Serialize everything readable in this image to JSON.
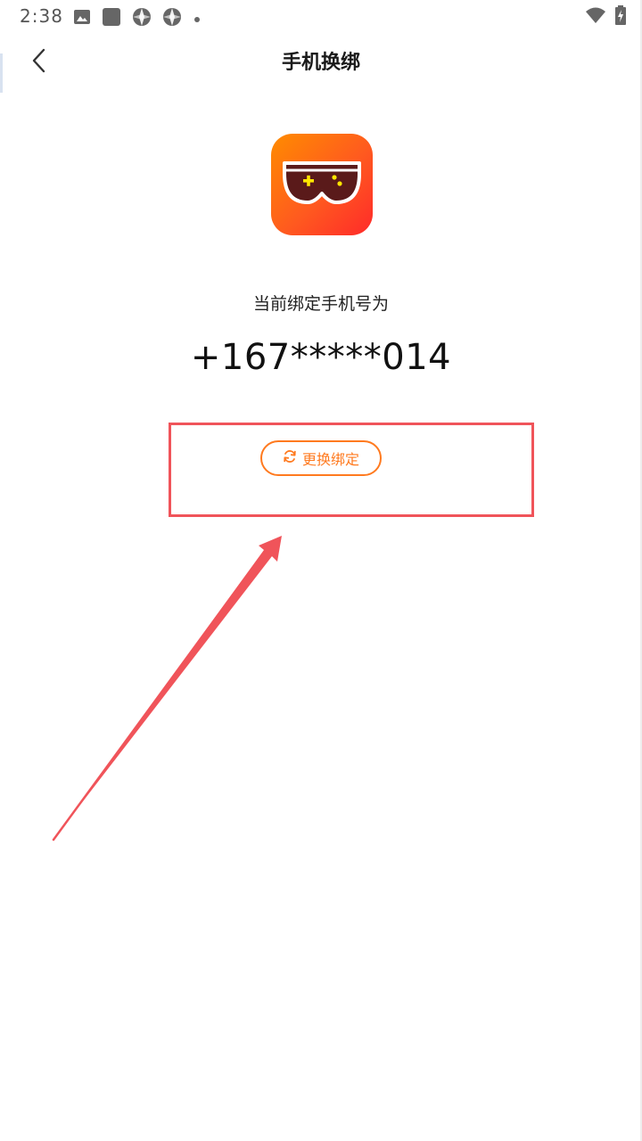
{
  "status_bar": {
    "time": "2:38",
    "left_icons": [
      "image-icon",
      "square-app-icon",
      "aperture-icon",
      "aperture-icon",
      "dot-icon"
    ],
    "right_icons": [
      "wifi-icon",
      "battery-charging-icon"
    ]
  },
  "nav": {
    "title": "手机换绑",
    "back_icon": "chevron-left-icon"
  },
  "logo": {
    "icon": "gamepad-glasses-icon",
    "colors": {
      "start": "#ff8c00",
      "end": "#ff2a2a",
      "accent": "#ffe600"
    }
  },
  "binding": {
    "label": "当前绑定手机号为",
    "phone": "+167*****014"
  },
  "actions": {
    "change_label": "更换绑定",
    "change_icon": "refresh-icon",
    "accent_color": "#ff7a1f"
  },
  "annotation": {
    "color": "#f0545a"
  }
}
